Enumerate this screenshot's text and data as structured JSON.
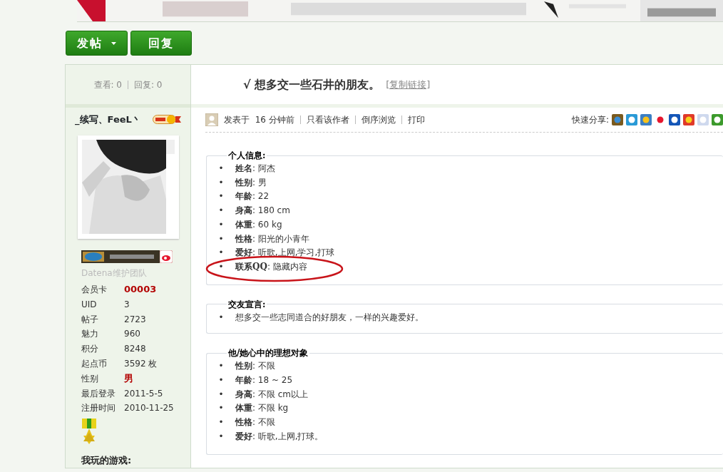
{
  "buttons": [
    {
      "label": "发帖",
      "kind": "dropdown"
    },
    {
      "label": "回复",
      "kind": "plain"
    }
  ],
  "post": {
    "stats": [
      {
        "label": "查看:",
        "value": "0"
      },
      {
        "label": "回复:",
        "value": "0"
      }
    ],
    "title_mark": "√",
    "title": "想多交一些石井的朋友。",
    "copy_link": "[复制链接]"
  },
  "author": {
    "name": "_续写、FeeL丶",
    "group": "Datena维护团队",
    "fields": [
      {
        "label": "会员卡",
        "value": "00003",
        "emphasis": true
      },
      {
        "label": "UID",
        "value": "3",
        "emphasis": false
      },
      {
        "label": "帖子",
        "value": "2723",
        "emphasis": false
      },
      {
        "label": "魅力",
        "value": "960",
        "emphasis": false
      },
      {
        "label": "积分",
        "value": "8248",
        "emphasis": false
      },
      {
        "label": "起点币",
        "value": "3592 枚",
        "emphasis": false
      },
      {
        "label": "性别",
        "value": "男",
        "emphasis": true
      },
      {
        "label": "最后登录",
        "value": "2011-5-5",
        "emphasis": false
      },
      {
        "label": "注册时间",
        "value": "2010-11-25",
        "emphasis": false
      }
    ],
    "games_heading": "我玩的游戏:"
  },
  "meta": {
    "posted_label": "发表于",
    "time": "16 分钟前",
    "links": [
      "只看该作者",
      "倒序浏览",
      "打印"
    ],
    "share_label": "快速分享:"
  },
  "sections": [
    {
      "legend": "个人信息:",
      "marker": "•",
      "items": [
        {
          "text": "**姓名**: 阿杰",
          "circled": false
        },
        {
          "text": "**性别**: 男",
          "circled": false
        },
        {
          "text": "**年龄**: 22",
          "circled": false
        },
        {
          "text": "**身高**: 180 cm",
          "circled": false
        },
        {
          "text": "**体重**: 60 kg",
          "circled": false
        },
        {
          "text": "**性格**: 阳光的小青年",
          "circled": false
        },
        {
          "text": "**爱好**: 听歌,上网,学习,打球",
          "circled": false
        },
        {
          "text": "**联系QQ**: 隐藏内容",
          "circled": true
        }
      ]
    },
    {
      "legend": "交友宣言:",
      "marker": "•",
      "items": [
        {
          "text": "想多交一些志同道合的好朋友，一样的兴趣爱好。",
          "circled": false
        }
      ]
    },
    {
      "legend": "他/她心中的理想对象",
      "marker": "•",
      "items": [
        {
          "text": "**性别**: 不限",
          "circled": false
        },
        {
          "text": "**年龄**: 18 ~ 25",
          "circled": false
        },
        {
          "text": "**身高**: 不限  cm以上",
          "circled": false
        },
        {
          "text": "**体重**: 不限  kg",
          "circled": false
        },
        {
          "text": "**性格**: 不限",
          "circled": false
        },
        {
          "text": "**爱好**: 听歌,上网,打球。",
          "circled": false
        }
      ]
    }
  ]
}
